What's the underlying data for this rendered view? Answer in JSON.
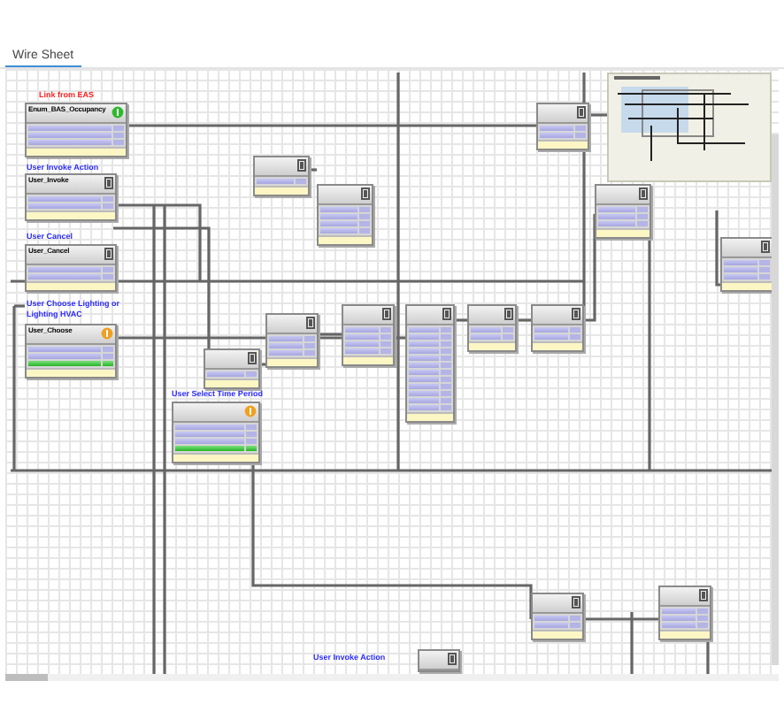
{
  "tabs": [
    {
      "label": "Wire Sheet",
      "selected": true
    }
  ],
  "labels": [
    {
      "text": "Link from EAS",
      "color": "#ff2020"
    },
    {
      "text": "User Invoke Action",
      "color": "#2a2aff"
    },
    {
      "text": "User Cancel",
      "color": "#2a2aff"
    },
    {
      "text": "User Choose Lighting or Lighting HVAC",
      "color": "#2a2aff"
    },
    {
      "text": "User Select Time Period",
      "color": "#2a2aff"
    },
    {
      "text": "User Invoke Action",
      "color": "#2a2aff"
    }
  ],
  "blocks": [
    {
      "kind": "status",
      "title": "Enum_BAS_Occupancy"
    },
    {
      "kind": "logic",
      "title": "User_Invoke"
    },
    {
      "kind": "logic",
      "title": "User_Cancel"
    },
    {
      "kind": "numeric",
      "title": "User_Choose",
      "active": true
    },
    {
      "kind": "logic"
    },
    {
      "kind": "logic"
    },
    {
      "kind": "logic"
    },
    {
      "kind": "logic"
    },
    {
      "kind": "numeric",
      "active": true
    },
    {
      "kind": "logic"
    },
    {
      "kind": "logic"
    },
    {
      "kind": "logic"
    },
    {
      "kind": "logic"
    },
    {
      "kind": "logic"
    },
    {
      "kind": "logic"
    },
    {
      "kind": "logic"
    },
    {
      "kind": "logic"
    },
    {
      "kind": "logic"
    },
    {
      "kind": "logic"
    }
  ]
}
